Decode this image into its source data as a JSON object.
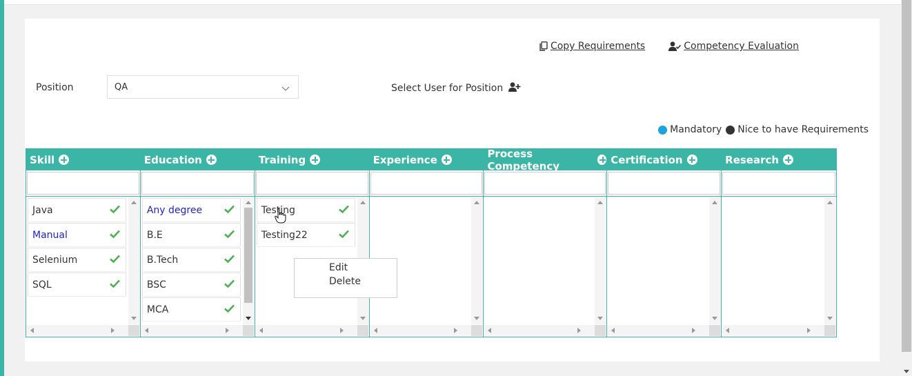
{
  "header": {
    "copy_requirements": "Copy Requirements",
    "competency_evaluation": "Competency Evaluation"
  },
  "position": {
    "label": "Position",
    "value": "QA"
  },
  "select_user": {
    "label": "Select User for Position"
  },
  "legend": {
    "mandatory": {
      "label": "Mandatory",
      "color": "#1aa3e0"
    },
    "nice": {
      "label": "Nice to have Requirements",
      "color": "#333333"
    }
  },
  "columns": [
    {
      "title": "Skill",
      "items": [
        {
          "label": "Java",
          "style": "normal"
        },
        {
          "label": "Manual",
          "style": "blue"
        },
        {
          "label": "Selenium",
          "style": "normal"
        },
        {
          "label": "SQL",
          "style": "normal"
        }
      ]
    },
    {
      "title": "Education",
      "items": [
        {
          "label": "Any degree",
          "style": "blue"
        },
        {
          "label": "B.E",
          "style": "normal"
        },
        {
          "label": "B.Tech",
          "style": "normal"
        },
        {
          "label": "BSC",
          "style": "normal"
        },
        {
          "label": "MCA",
          "style": "normal"
        }
      ]
    },
    {
      "title": "Training",
      "items": [
        {
          "label": "Testing",
          "style": "normal"
        },
        {
          "label": "Testing22",
          "style": "normal"
        }
      ]
    },
    {
      "title": "Experience",
      "items": []
    },
    {
      "title": "Process Competency",
      "items": []
    },
    {
      "title": "Certification",
      "items": []
    },
    {
      "title": "Research",
      "items": []
    }
  ],
  "context_menu": {
    "edit": "Edit",
    "delete": "Delete"
  },
  "colors": {
    "accent": "#3bb5a6",
    "check": "#4caf50",
    "link_blue": "#2222cc"
  },
  "icons": {
    "copy": "copy-icon",
    "evaluation": "user-check-icon",
    "add_user": "user-plus-icon",
    "add_column_item": "plus-circle-icon",
    "check": "check-icon",
    "dropdown": "chevron-down-icon"
  }
}
